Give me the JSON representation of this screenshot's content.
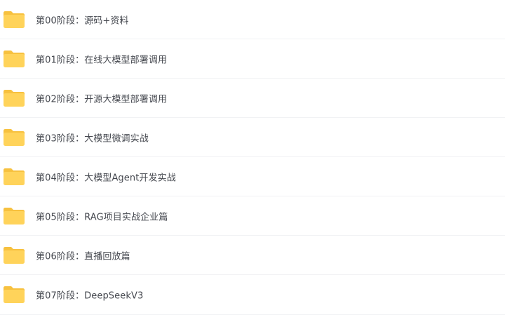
{
  "folders": [
    {
      "name": "第00阶段：源码+资料",
      "icon": "folder-icon"
    },
    {
      "name": "第01阶段：在线大模型部署调用",
      "icon": "folder-icon"
    },
    {
      "name": "第02阶段：开源大模型部署调用",
      "icon": "folder-icon"
    },
    {
      "name": "第03阶段：大模型微调实战",
      "icon": "folder-icon"
    },
    {
      "name": "第04阶段：大模型Agent开发实战",
      "icon": "folder-icon"
    },
    {
      "name": "第05阶段：RAG项目实战企业篇",
      "icon": "folder-icon"
    },
    {
      "name": "第06阶段：直播回放篇",
      "icon": "folder-icon"
    },
    {
      "name": "第07阶段：DeepSeekV3",
      "icon": "folder-icon"
    }
  ],
  "colors": {
    "folder": "#ffd35a",
    "folder_tab": "#f7c13f",
    "text": "#45484f",
    "divider": "#f1f2f4"
  }
}
